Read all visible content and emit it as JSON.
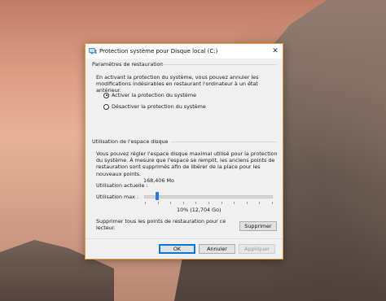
{
  "dialog": {
    "title": "Protection système pour Disque local (C:)",
    "close_glyph": "✕"
  },
  "restore": {
    "heading": "Paramètres de restauration",
    "description": "En activant la protection du système, vous pouvez annuler les modifications indésirables en restaurant l'ordinateur à un état antérieur.",
    "option_on": "Activer la protection du système",
    "option_off": "Désactiver la protection du système",
    "selected": "on"
  },
  "disk": {
    "heading": "Utilisation de l'espace disque",
    "description": "Vous pouvez régler l'espace disque maximal utilisé pour la protection du système. À mesure que l'espace se remplit, les anciens points de restauration sont supprimés afin de libérer de la place pour les nouveaux points.",
    "current_label": "Utilisation actuelle :",
    "current_value": "168,406 Mo",
    "max_label": "Utilisation max :",
    "max_value": "10% (12,704 Go)",
    "max_fraction": 0.1,
    "delete_text": "Supprimer tous les points de restauration pour ce lecteur.",
    "delete_button": "Supprimer"
  },
  "buttons": {
    "ok": "OK",
    "cancel": "Annuler",
    "apply": "Appliquer"
  }
}
